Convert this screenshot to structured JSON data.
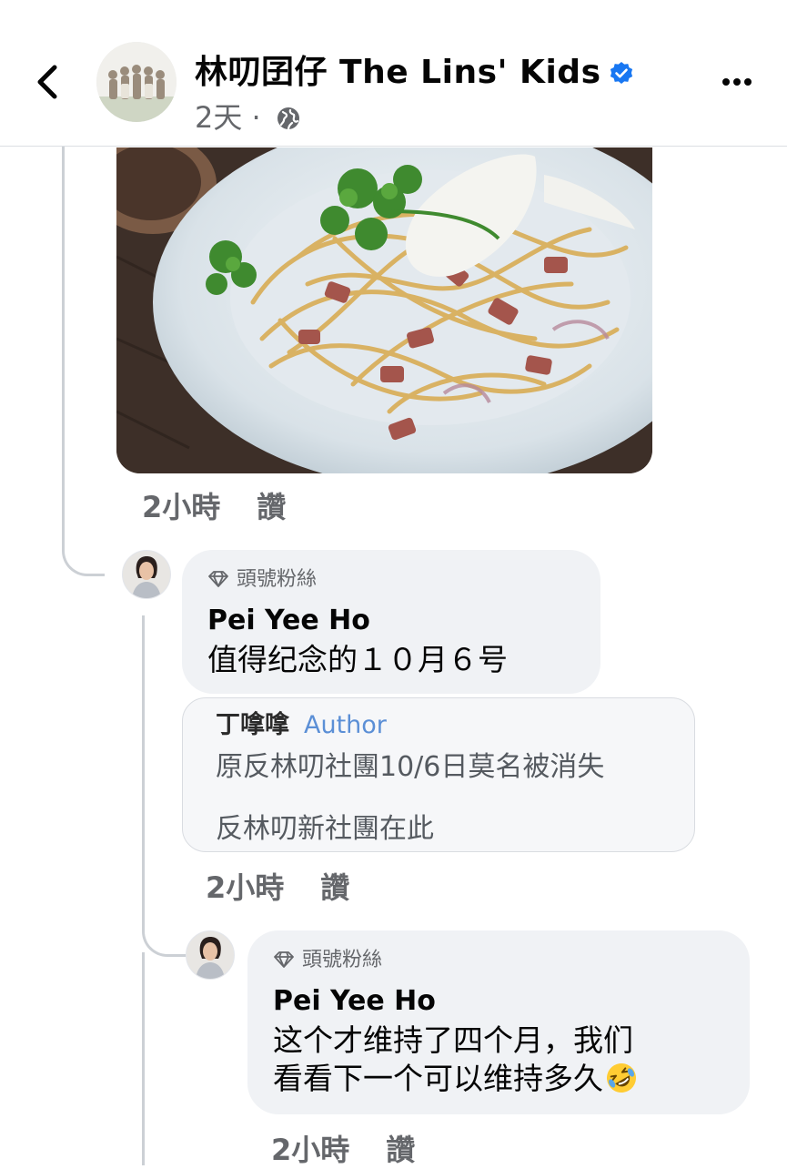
{
  "header": {
    "page_name": "林叨囝仔 The Lins' Kids",
    "time": "2天",
    "separator": "·",
    "icons": {
      "back": "chevron-left-icon",
      "verified": "verified-badge-icon",
      "audience": "globe-icon",
      "more": "more-horizontal-icon"
    },
    "accent_color": "#1877f2"
  },
  "photo_comment": {
    "image": "spaghetti-photo",
    "time": "2小時",
    "like_label": "讚"
  },
  "comments": [
    {
      "badge": "頭號粉絲",
      "author": "Pei Yee Ho",
      "text": "值得纪念的１０月６号",
      "time": "2小時",
      "like_label": "讚",
      "quoted_screenshot": {
        "name": "丁嗱嗱",
        "role": "Author",
        "lines": [
          "原反林叨社團10/6日莫名被消失",
          "反林叨新社團在此"
        ]
      }
    },
    {
      "badge": "頭號粉絲",
      "author": "Pei Yee Ho",
      "text_lines": [
        "这个才维持了四个月，我们",
        "看看下一个可以维持多久"
      ],
      "emoji": "rolling-on-floor-laughing-emoji",
      "time": "2小時",
      "like_label": "讚"
    }
  ],
  "colors": {
    "bubble": "#f0f2f5",
    "meta_text": "#65676b",
    "thread_line": "#ccd0d5"
  }
}
